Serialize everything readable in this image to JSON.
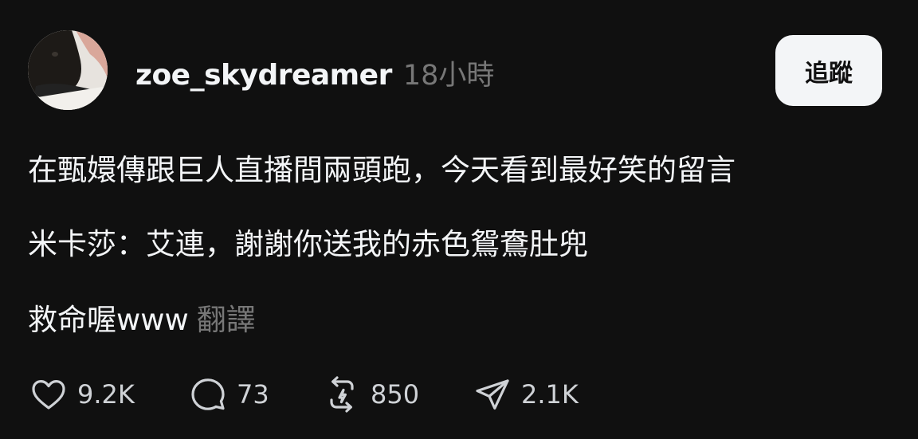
{
  "post": {
    "username": "zoe_skydreamer",
    "timestamp": "18小時",
    "follow_label": "追蹤",
    "paragraphs": [
      "在甄嬛傳跟巨人直播間兩頭跑，今天看到最好笑的留言",
      "米卡莎：艾連，謝謝你送我的赤色鴛鴦肚兜",
      "救命喔www"
    ],
    "translate_label": "翻譯"
  },
  "actions": {
    "like": {
      "icon": "heart-icon",
      "count": "9.2K"
    },
    "reply": {
      "icon": "comment-icon",
      "count": "73"
    },
    "repost": {
      "icon": "repost-icon",
      "count": "850"
    },
    "share": {
      "icon": "send-icon",
      "count": "2.1K"
    }
  },
  "colors": {
    "background": "#101010",
    "text_primary": "#f3f5f7",
    "text_secondary": "#777777",
    "button_bg": "#f3f5f7"
  }
}
